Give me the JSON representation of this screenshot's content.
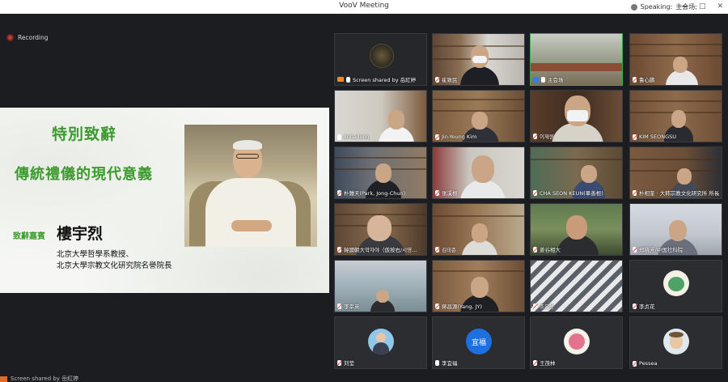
{
  "window": {
    "title": "VooV Meeting",
    "speaking_prefix": "Speaking:",
    "speaking_name": "主会场;",
    "controls": [
      "—",
      "□",
      "✕"
    ]
  },
  "recording": {
    "label": "Recording"
  },
  "slide": {
    "title_line1": "特別致辭",
    "title_line2": "傳統禮儀的現代意義",
    "speaker_label": "致辭嘉賓",
    "speaker_name": "樓宇烈",
    "affiliation_1": "北京大學哲學系教授、",
    "affiliation_2": "北京大學宗教文化研究院名譽院長"
  },
  "bottom_bar": {
    "text": "Screen shared by  岳紅婷"
  },
  "participants": [
    {
      "name": "Screen shared by 岳紅婷",
      "type": "shared"
    },
    {
      "name": "崔致民"
    },
    {
      "name": "主会场",
      "host": true
    },
    {
      "name": "鲁心鹏"
    },
    {
      "name": "Jinhailong"
    },
    {
      "name": "Jin-Young Kim"
    },
    {
      "name": "이재원"
    },
    {
      "name": "KIM SEONGSU"
    },
    {
      "name": "朴鍾天(Park, Jong-Chun)"
    },
    {
      "name": "张溪根"
    },
    {
      "name": "CHA SEON KEUN(車善根)"
    },
    {
      "name": "朴相奎 · 大韩宗教文化研究所 所長"
    },
    {
      "name": "韓國朝大학자야（仮按右/시영…"
    },
    {
      "name": "김태준"
    },
    {
      "name": "姜谷相大"
    },
    {
      "name": "郑晓芳/中国社科院"
    },
    {
      "name": "李幸英"
    },
    {
      "name": "蔣昌源(Yang, JY)"
    },
    {
      "name": "조은용"
    },
    {
      "name": "李贞花"
    },
    {
      "name": "刘莹"
    },
    {
      "name": "李宜福",
      "avatar_text": "宜福"
    },
    {
      "name": "王茂林"
    },
    {
      "name": "Pessea"
    }
  ],
  "colors": {
    "accent_green": "#3c9a2e",
    "active_border": "#2fb24c",
    "record_red": "#c93a33"
  }
}
